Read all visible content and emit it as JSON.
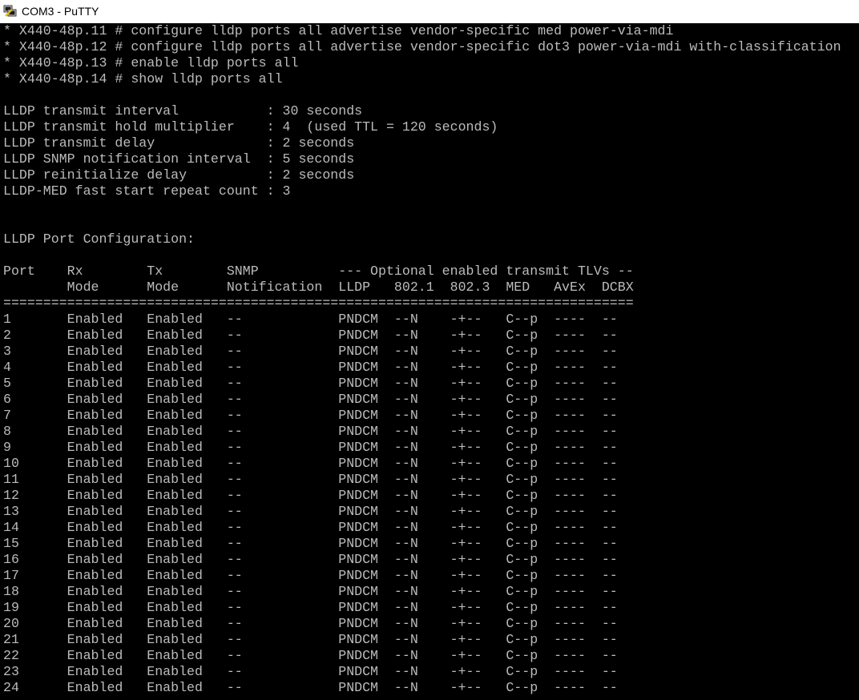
{
  "window": {
    "title": "COM3 - PuTTY",
    "icon": "putty-icon",
    "colors": {
      "background": "#000000",
      "text": "#bbbbbb",
      "titlebar": "#ffffff"
    }
  },
  "terminal": {
    "lines": [
      "* X440-48p.11 # configure lldp ports all advertise vendor-specific med power-via-mdi",
      "* X440-48p.12 # configure lldp ports all advertise vendor-specific dot3 power-via-mdi with-classification",
      "* X440-48p.13 # enable lldp ports all",
      "* X440-48p.14 # show lldp ports all",
      "",
      "LLDP transmit interval           : 30 seconds",
      "LLDP transmit hold multiplier    : 4  (used TTL = 120 seconds)",
      "LLDP transmit delay              : 2 seconds",
      "LLDP SNMP notification interval  : 5 seconds",
      "LLDP reinitialize delay          : 2 seconds",
      "LLDP-MED fast start repeat count : 3",
      "",
      "",
      "LLDP Port Configuration:",
      "",
      "Port    Rx        Tx        SNMP          --- Optional enabled transmit TLVs --",
      "        Mode      Mode      Notification  LLDP   802.1  802.3  MED   AvEx  DCBX",
      "===============================================================================",
      "1       Enabled   Enabled   --            PNDCM  --N    -+--   C--p  ----  --",
      "2       Enabled   Enabled   --            PNDCM  --N    -+--   C--p  ----  --",
      "3       Enabled   Enabled   --            PNDCM  --N    -+--   C--p  ----  --",
      "4       Enabled   Enabled   --            PNDCM  --N    -+--   C--p  ----  --",
      "5       Enabled   Enabled   --            PNDCM  --N    -+--   C--p  ----  --",
      "6       Enabled   Enabled   --            PNDCM  --N    -+--   C--p  ----  --",
      "7       Enabled   Enabled   --            PNDCM  --N    -+--   C--p  ----  --",
      "8       Enabled   Enabled   --            PNDCM  --N    -+--   C--p  ----  --",
      "9       Enabled   Enabled   --            PNDCM  --N    -+--   C--p  ----  --",
      "10      Enabled   Enabled   --            PNDCM  --N    -+--   C--p  ----  --",
      "11      Enabled   Enabled   --            PNDCM  --N    -+--   C--p  ----  --",
      "12      Enabled   Enabled   --            PNDCM  --N    -+--   C--p  ----  --",
      "13      Enabled   Enabled   --            PNDCM  --N    -+--   C--p  ----  --",
      "14      Enabled   Enabled   --            PNDCM  --N    -+--   C--p  ----  --",
      "15      Enabled   Enabled   --            PNDCM  --N    -+--   C--p  ----  --",
      "16      Enabled   Enabled   --            PNDCM  --N    -+--   C--p  ----  --",
      "17      Enabled   Enabled   --            PNDCM  --N    -+--   C--p  ----  --",
      "18      Enabled   Enabled   --            PNDCM  --N    -+--   C--p  ----  --",
      "19      Enabled   Enabled   --            PNDCM  --N    -+--   C--p  ----  --",
      "20      Enabled   Enabled   --            PNDCM  --N    -+--   C--p  ----  --",
      "21      Enabled   Enabled   --            PNDCM  --N    -+--   C--p  ----  --",
      "22      Enabled   Enabled   --            PNDCM  --N    -+--   C--p  ----  --",
      "23      Enabled   Enabled   --            PNDCM  --N    -+--   C--p  ----  --",
      "24      Enabled   Enabled   --            PNDCM  --N    -+--   C--p  ----  --"
    ]
  }
}
